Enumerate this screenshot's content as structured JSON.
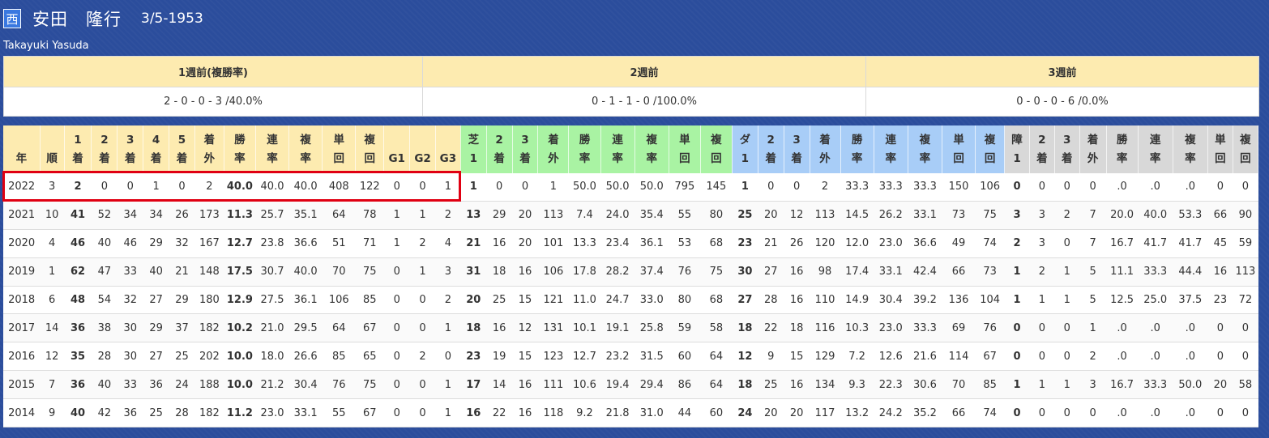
{
  "jockey": {
    "region_badge": "西",
    "name": "安田　隆行",
    "dob": "3/5-1953",
    "romaji": "Takayuki Yasuda"
  },
  "weeks": {
    "headers": [
      "1週前(複勝率)",
      "2週前",
      "3週前"
    ],
    "values": [
      "2 - 0 - 0 - 3 /40.0%",
      "0 - 1 - 1 - 0 /100.0%",
      "0 - 0 - 0 - 6 /0.0%"
    ]
  },
  "stats": {
    "headers": [
      [
        "",
        "年"
      ],
      [
        "",
        "順"
      ],
      [
        "1",
        "着"
      ],
      [
        "2",
        "着"
      ],
      [
        "3",
        "着"
      ],
      [
        "4",
        "着"
      ],
      [
        "5",
        "着"
      ],
      [
        "着",
        "外"
      ],
      [
        "勝",
        "率"
      ],
      [
        "連",
        "率"
      ],
      [
        "複",
        "率"
      ],
      [
        "単",
        "回"
      ],
      [
        "複",
        "回"
      ],
      [
        "",
        "G1"
      ],
      [
        "",
        "G2"
      ],
      [
        "",
        "G3"
      ],
      [
        "芝",
        "1"
      ],
      [
        "2",
        "着"
      ],
      [
        "3",
        "着"
      ],
      [
        "着",
        "外"
      ],
      [
        "勝",
        "率"
      ],
      [
        "連",
        "率"
      ],
      [
        "複",
        "率"
      ],
      [
        "単",
        "回"
      ],
      [
        "複",
        "回"
      ],
      [
        "ダ",
        "1"
      ],
      [
        "2",
        "着"
      ],
      [
        "3",
        "着"
      ],
      [
        "着",
        "外"
      ],
      [
        "勝",
        "率"
      ],
      [
        "連",
        "率"
      ],
      [
        "複",
        "率"
      ],
      [
        "単",
        "回"
      ],
      [
        "複",
        "回"
      ],
      [
        "障",
        "1"
      ],
      [
        "2",
        "着"
      ],
      [
        "3",
        "着"
      ],
      [
        "着",
        "外"
      ],
      [
        "勝",
        "率"
      ],
      [
        "連",
        "率"
      ],
      [
        "複",
        "率"
      ],
      [
        "単",
        "回"
      ],
      [
        "複",
        "回"
      ]
    ],
    "rows": [
      [
        "2022",
        "3",
        "2",
        "0",
        "0",
        "1",
        "0",
        "2",
        "40.0",
        "40.0",
        "40.0",
        "408",
        "122",
        "0",
        "0",
        "1",
        "1",
        "0",
        "0",
        "1",
        "50.0",
        "50.0",
        "50.0",
        "795",
        "145",
        "1",
        "0",
        "0",
        "2",
        "33.3",
        "33.3",
        "33.3",
        "150",
        "106",
        "0",
        "0",
        "0",
        "0",
        ".0",
        ".0",
        ".0",
        "0",
        "0"
      ],
      [
        "2021",
        "10",
        "41",
        "52",
        "34",
        "34",
        "26",
        "173",
        "11.3",
        "25.7",
        "35.1",
        "64",
        "78",
        "1",
        "1",
        "2",
        "13",
        "29",
        "20",
        "113",
        "7.4",
        "24.0",
        "35.4",
        "55",
        "80",
        "25",
        "20",
        "12",
        "113",
        "14.5",
        "26.2",
        "33.1",
        "73",
        "75",
        "3",
        "3",
        "2",
        "7",
        "20.0",
        "40.0",
        "53.3",
        "66",
        "90"
      ],
      [
        "2020",
        "4",
        "46",
        "40",
        "46",
        "29",
        "32",
        "167",
        "12.7",
        "23.8",
        "36.6",
        "51",
        "71",
        "1",
        "2",
        "4",
        "21",
        "16",
        "20",
        "101",
        "13.3",
        "23.4",
        "36.1",
        "53",
        "68",
        "23",
        "21",
        "26",
        "120",
        "12.0",
        "23.0",
        "36.6",
        "49",
        "74",
        "2",
        "3",
        "0",
        "7",
        "16.7",
        "41.7",
        "41.7",
        "45",
        "59"
      ],
      [
        "2019",
        "1",
        "62",
        "47",
        "33",
        "40",
        "21",
        "148",
        "17.5",
        "30.7",
        "40.0",
        "70",
        "75",
        "0",
        "1",
        "3",
        "31",
        "18",
        "16",
        "106",
        "17.8",
        "28.2",
        "37.4",
        "76",
        "75",
        "30",
        "27",
        "16",
        "98",
        "17.4",
        "33.1",
        "42.4",
        "66",
        "73",
        "1",
        "2",
        "1",
        "5",
        "11.1",
        "33.3",
        "44.4",
        "16",
        "113"
      ],
      [
        "2018",
        "6",
        "48",
        "54",
        "32",
        "27",
        "29",
        "180",
        "12.9",
        "27.5",
        "36.1",
        "106",
        "85",
        "0",
        "0",
        "2",
        "20",
        "25",
        "15",
        "121",
        "11.0",
        "24.7",
        "33.0",
        "80",
        "68",
        "27",
        "28",
        "16",
        "110",
        "14.9",
        "30.4",
        "39.2",
        "136",
        "104",
        "1",
        "1",
        "1",
        "5",
        "12.5",
        "25.0",
        "37.5",
        "23",
        "72"
      ],
      [
        "2017",
        "14",
        "36",
        "38",
        "30",
        "29",
        "37",
        "182",
        "10.2",
        "21.0",
        "29.5",
        "64",
        "67",
        "0",
        "0",
        "1",
        "18",
        "16",
        "12",
        "131",
        "10.1",
        "19.1",
        "25.8",
        "59",
        "58",
        "18",
        "22",
        "18",
        "116",
        "10.3",
        "23.0",
        "33.3",
        "69",
        "76",
        "0",
        "0",
        "0",
        "1",
        ".0",
        ".0",
        ".0",
        "0",
        "0"
      ],
      [
        "2016",
        "12",
        "35",
        "28",
        "30",
        "27",
        "25",
        "202",
        "10.0",
        "18.0",
        "26.6",
        "85",
        "65",
        "0",
        "2",
        "0",
        "23",
        "19",
        "15",
        "123",
        "12.7",
        "23.2",
        "31.5",
        "60",
        "64",
        "12",
        "9",
        "15",
        "129",
        "7.2",
        "12.6",
        "21.6",
        "114",
        "67",
        "0",
        "0",
        "0",
        "2",
        ".0",
        ".0",
        ".0",
        "0",
        "0"
      ],
      [
        "2015",
        "7",
        "36",
        "40",
        "33",
        "36",
        "24",
        "188",
        "10.0",
        "21.2",
        "30.4",
        "76",
        "75",
        "0",
        "0",
        "1",
        "17",
        "14",
        "16",
        "111",
        "10.6",
        "19.4",
        "29.4",
        "86",
        "64",
        "18",
        "25",
        "16",
        "134",
        "9.3",
        "22.3",
        "30.6",
        "70",
        "85",
        "1",
        "1",
        "1",
        "3",
        "16.7",
        "33.3",
        "50.0",
        "20",
        "58"
      ],
      [
        "2014",
        "9",
        "40",
        "42",
        "36",
        "25",
        "28",
        "182",
        "11.2",
        "23.0",
        "33.1",
        "55",
        "67",
        "0",
        "0",
        "1",
        "16",
        "22",
        "16",
        "118",
        "9.2",
        "21.8",
        "31.0",
        "44",
        "60",
        "24",
        "20",
        "20",
        "117",
        "13.2",
        "24.2",
        "35.2",
        "66",
        "74",
        "0",
        "0",
        "0",
        "0",
        ".0",
        ".0",
        ".0",
        "0",
        "0"
      ]
    ]
  },
  "colors": {
    "background": "#2b4d9c",
    "all_header": "#fdebb0",
    "turf_header": "#a9f3a3",
    "dirt_header": "#a8cdf7",
    "jump_header": "#d8d8d8",
    "highlight": "#e00012"
  }
}
